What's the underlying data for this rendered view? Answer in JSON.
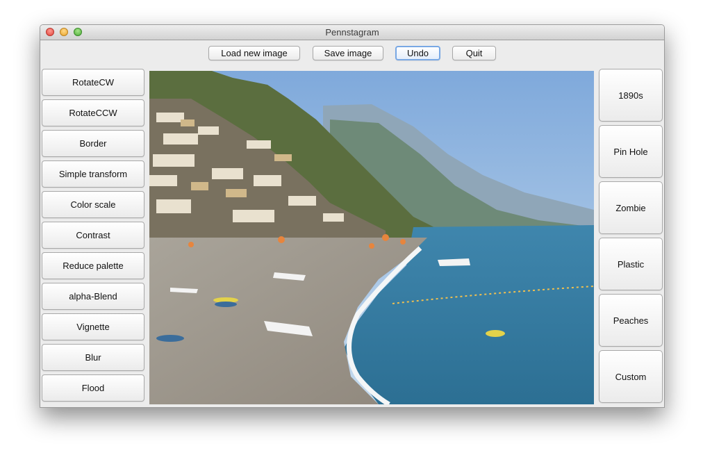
{
  "window": {
    "title": "Pennstagram"
  },
  "toolbar": {
    "load_label": "Load new image",
    "save_label": "Save image",
    "undo_label": "Undo",
    "quit_label": "Quit"
  },
  "transforms": [
    "RotateCW",
    "RotateCCW",
    "Border",
    "Simple transform",
    "Color scale",
    "Contrast",
    "Reduce palette",
    "alpha-Blend",
    "Vignette",
    "Blur",
    "Flood"
  ],
  "filters": [
    "1890s",
    "Pin Hole",
    "Zombie",
    "Plastic",
    "Peaches",
    "Custom"
  ],
  "image": {
    "subject": "coastal-beach-photo"
  },
  "colors": {
    "focus_ring": "#79a8e4",
    "window_bg": "#ececec"
  }
}
